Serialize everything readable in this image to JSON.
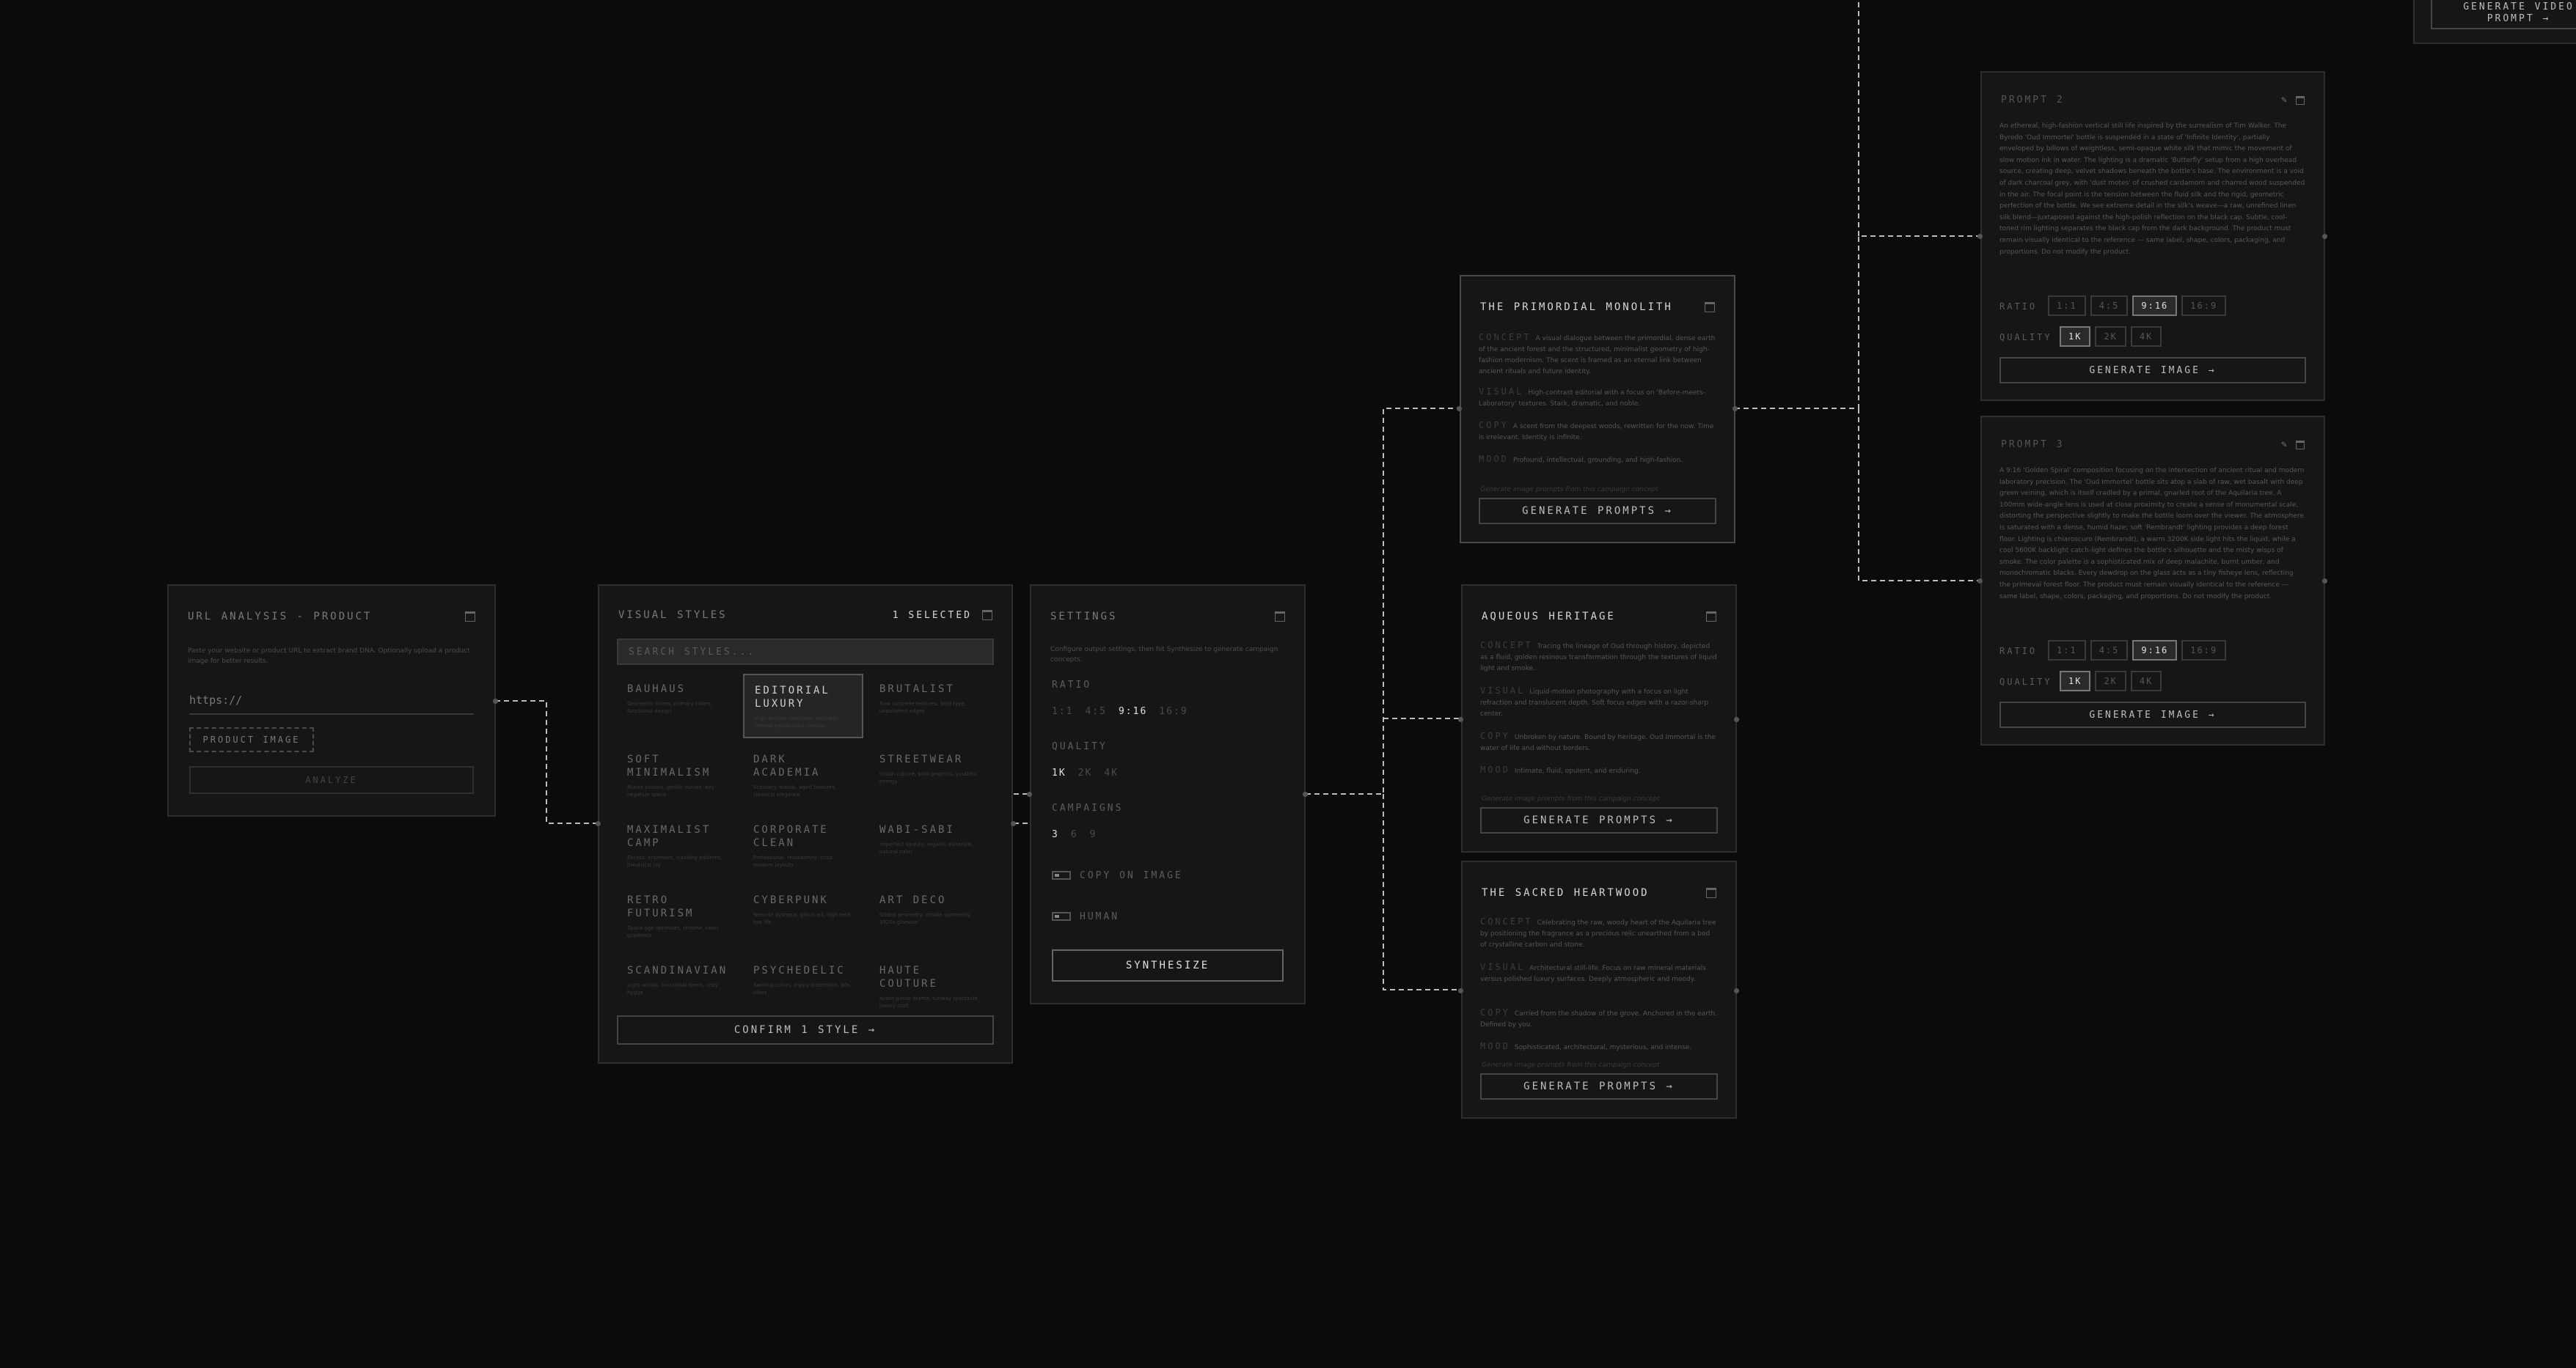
{
  "url_card": {
    "title": "URL ANALYSIS - PRODUCT",
    "description": "Paste your website or product URL to extract brand DNA. Optionally upload a product image for better results.",
    "url_placeholder": "https://",
    "product_image_label": "PRODUCT IMAGE",
    "analyze_label": "ANALYZE",
    "icons": [
      "trash-icon"
    ]
  },
  "styles_card": {
    "title": "VISUAL STYLES",
    "selected_count": "1 SELECTED",
    "search_placeholder": "SEARCH STYLES...",
    "confirm_label": "CONFIRM 1 STYLE →",
    "styles": [
      {
        "name": "BAUHAUS",
        "desc": "Geometric forms, primary colors, functional design",
        "selected": false
      },
      {
        "name": "EDITORIAL LUXURY",
        "desc": "High fashion magazine aesthetic, refined typographic layouts",
        "selected": true
      },
      {
        "name": "BRUTALIST",
        "desc": "Raw concrete textures, bold type, unpolished edges",
        "selected": false
      },
      {
        "name": "SOFT MINIMALISM",
        "desc": "Muted pastels, gentle curves, airy negative space",
        "selected": false
      },
      {
        "name": "DARK ACADEMIA",
        "desc": "Scholarly moods, aged textures, classical elegance",
        "selected": false
      },
      {
        "name": "STREETWEAR",
        "desc": "Urban culture, bold graphics, youthful energy",
        "selected": false
      },
      {
        "name": "MAXIMALIST CAMP",
        "desc": "Excess, ornament, clashing patterns, theatrical joy",
        "selected": false
      },
      {
        "name": "CORPORATE CLEAN",
        "desc": "Professional, trustworthy, crisp modern layouts",
        "selected": false
      },
      {
        "name": "WABI-SABI",
        "desc": "Imperfect beauty, organic materials, natural calm",
        "selected": false
      },
      {
        "name": "RETRO FUTURISM",
        "desc": "Space age optimism, chrome, neon gradients",
        "selected": false
      },
      {
        "name": "CYBERPUNK",
        "desc": "Neon-lit dystopia, glitch art, high tech low life",
        "selected": false
      },
      {
        "name": "ART DECO",
        "desc": "Gilded geometry, ornate symmetry, 1920s glamour",
        "selected": false
      },
      {
        "name": "SCANDINAVIAN",
        "desc": "Light woods, functional forms, cozy hygge",
        "selected": false
      },
      {
        "name": "PSYCHEDELIC",
        "desc": "Swirling colors, trippy distortions, 60s vibes",
        "selected": false
      },
      {
        "name": "HAUTE COUTURE",
        "desc": "Avant-garde drama, runway spectacle, luxury craft",
        "selected": false
      }
    ]
  },
  "settings_card": {
    "title": "SETTINGS",
    "description": "Configure output settings, then hit Synthesize to generate campaign concepts.",
    "ratio_label": "RATIO",
    "ratio_options": [
      "1:1",
      "4:5",
      "9:16",
      "16:9"
    ],
    "ratio_selected": "9:16",
    "quality_label": "QUALITY",
    "quality_options": [
      "1K",
      "2K",
      "4K"
    ],
    "quality_selected": "1K",
    "campaigns_label": "CAMPAIGNS",
    "campaign_options": [
      "3",
      "6",
      "9"
    ],
    "campaigns_selected": "3",
    "copy_on_image_label": "COPY ON IMAGE",
    "human_label": "HUMAN",
    "synthesize_label": "SYNTHESIZE"
  },
  "concepts": [
    {
      "title": "THE PRIMORDIAL MONOLITH",
      "concept": "A visual dialogue between the primordial, dense earth of the ancient forest and the structured, minimalist geometry of high-fashion modernism. The scent is framed as an eternal link between ancient rituals and future identity.",
      "visual": "High-contrast editorial with a focus on 'Before-meets-Laboratory' textures. Stark, dramatic, and noble.",
      "copy": "A scent from the deepest woods, rewritten for the now. Time is irrelevant. Identity is infinite.",
      "mood": "Profound, intellectual, grounding, and high-fashion.",
      "footnote": "Generate image prompts from this campaign concept",
      "button": "GENERATE PROMPTS →"
    },
    {
      "title": "AQUEOUS HERITAGE",
      "concept": "Tracing the lineage of Oud through history, depicted as a fluid, golden resinous transformation through the textures of liquid light and smoke.",
      "visual": "Liquid-motion photography with a focus on light refraction and translucent depth. Soft focus edges with a razor-sharp center.",
      "copy": "Unbroken by nature. Bound by heritage. Oud Immortal is the water of life and without borders.",
      "mood": "Intimate, fluid, opulent, and enduring.",
      "footnote": "Generate image prompts from this campaign concept",
      "button": "GENERATE PROMPTS →"
    },
    {
      "title": "THE SACRED HEARTWOOD",
      "concept": "Celebrating the raw, woody heart of the Aquilaria tree by positioning the fragrance as a precious relic unearthed from a bed of crystalline carbon and stone.",
      "visual": "Architectural still-life. Focus on raw mineral materials versus polished luxury surfaces. Deeply atmospheric and moody.",
      "copy": "Carried from the shadow of the grove. Anchored in the earth. Defined by you.",
      "mood": "Sophisticated, architectural, mysterious, and intense.",
      "footnote": "Generate image prompts from this campaign concept",
      "button": "GENERATE PROMPTS →"
    }
  ],
  "prompts": [
    {
      "title": "PROMPT 2",
      "body": "An ethereal, high-fashion vertical still life inspired by the surrealism of Tim Walker. The Byredo 'Oud Immortel' bottle is suspended in a state of 'Infinite Identity', partially enveloped by billows of weightless, semi-opaque white silk that mimic the movement of slow motion ink in water. The lighting is a dramatic 'Butterfly' setup from a high overhead source, creating deep, velvet shadows beneath the bottle's base. The environment is a void of dark charcoal grey, with 'dust motes' of crushed cardamom and charred wood suspended in the air. The focal point is the tension between the fluid silk and the rigid, geometric perfection of the bottle. We see extreme detail in the silk's weave—a raw, unrefined linen silk blend—juxtaposed against the high-polish reflection on the black cap. Subtle, cool-toned rim lighting separates the black cap from the dark background. The product must remain visually identical to the reference — same label, shape, colors, packaging, and proportions. Do not modify the product.",
      "ratio_label": "RATIO",
      "ratios": [
        "1:1",
        "4:5",
        "9:16",
        "16:9"
      ],
      "ratio_selected": "9:16",
      "quality_label": "QUALITY",
      "qualities": [
        "1K",
        "2K",
        "4K"
      ],
      "quality_selected": "1K",
      "button": "GENERATE IMAGE →"
    },
    {
      "title": "PROMPT 3",
      "body": "A 9:16 'Golden Spiral' composition focusing on the intersection of ancient ritual and modern laboratory precision. The 'Oud Immortel' bottle sits atop a slab of raw, wet basalt with deep green veining, which is itself cradled by a primal, gnarled root of the Aquilaria tree. A 100mm wide-angle lens is used at close proximity to create a sense of monumental scale, distorting the perspective slightly to make the bottle loom over the viewer. The atmosphere is saturated with a dense, humid haze; soft 'Rembrandt' lighting provides a deep forest floor. Lighting is chiaroscuro (Rembrandt), a warm 3200K side light hits the liquid, while a cool 5600K backlight catch-light defines the bottle's silhouette and the misty wisps of smoke. The color palette is a sophisticated mix of deep malachite, burnt umber, and monochromatic blacks. Every dewdrop on the glass acts as a tiny fisheye lens, reflecting the primeval forest floor. The product must remain visually identical to the reference — same label, shape, colors, packaging, and proportions. Do not modify the product.",
      "ratio_label": "RATIO",
      "ratios": [
        "1:1",
        "4:5",
        "9:16",
        "16:9"
      ],
      "ratio_selected": "9:16",
      "quality_label": "QUALITY",
      "qualities": [
        "1K",
        "2K",
        "4K"
      ],
      "quality_selected": "1K",
      "button": "GENERATE IMAGE →"
    }
  ],
  "video_button": {
    "line1": "GENERATE VIDEO",
    "line2": "PROMPT →"
  },
  "section_labels": {
    "concept": "CONCEPT",
    "visual": "VISUAL",
    "copy": "COPY",
    "mood": "MOOD"
  }
}
